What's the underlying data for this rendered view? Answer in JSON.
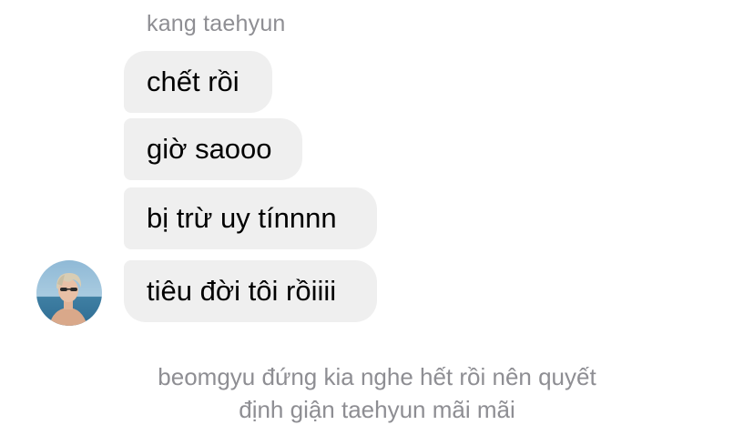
{
  "chat": {
    "sender_name": "kang taehyun",
    "messages": [
      {
        "text": "chết rồi"
      },
      {
        "text": "giờ saooo"
      },
      {
        "text": "bị trừ uy tínnnn"
      },
      {
        "text": "tiêu đời tôi rồiiii"
      }
    ],
    "system_message": {
      "line1": "beomgyu đứng kia nghe hết rồi nên quyết",
      "line2": "định giận taehyun mãi mãi"
    }
  },
  "colors": {
    "bubble_background": "#efefef",
    "secondary_text": "#8e8e93",
    "primary_text": "#000000"
  },
  "icons": {
    "avatar": "profile-photo"
  }
}
